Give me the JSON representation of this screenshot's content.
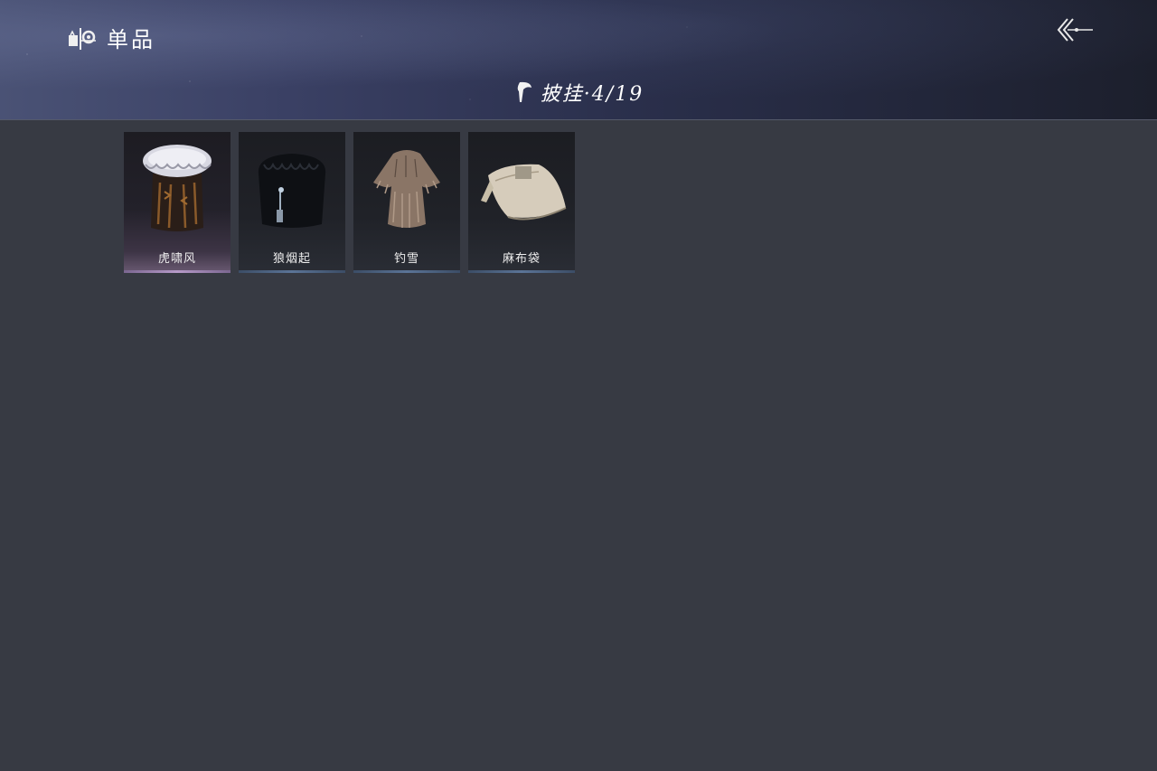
{
  "header": {
    "section_label": "单品",
    "section_icon": "wardrobe-icon",
    "back_icon": "back-arrow-icon"
  },
  "category": {
    "icon": "cape-icon",
    "title": "披挂·4/19",
    "owned": 4,
    "total": 19
  },
  "items": [
    {
      "name": "虎啸风",
      "icon": "fur-cape-icon",
      "rarity": "rare"
    },
    {
      "name": "狼烟起",
      "icon": "black-fur-cape-icon",
      "rarity": "common"
    },
    {
      "name": "钓雪",
      "icon": "straw-cape-icon",
      "rarity": "common"
    },
    {
      "name": "麻布袋",
      "icon": "cloth-sack-icon",
      "rarity": "common"
    }
  ],
  "colors": {
    "background": "#373a43",
    "header_dark": "#1c1f2c",
    "header_light": "#4a5275",
    "rare_accent": "#b69ac8",
    "common_accent": "#5b7497"
  }
}
